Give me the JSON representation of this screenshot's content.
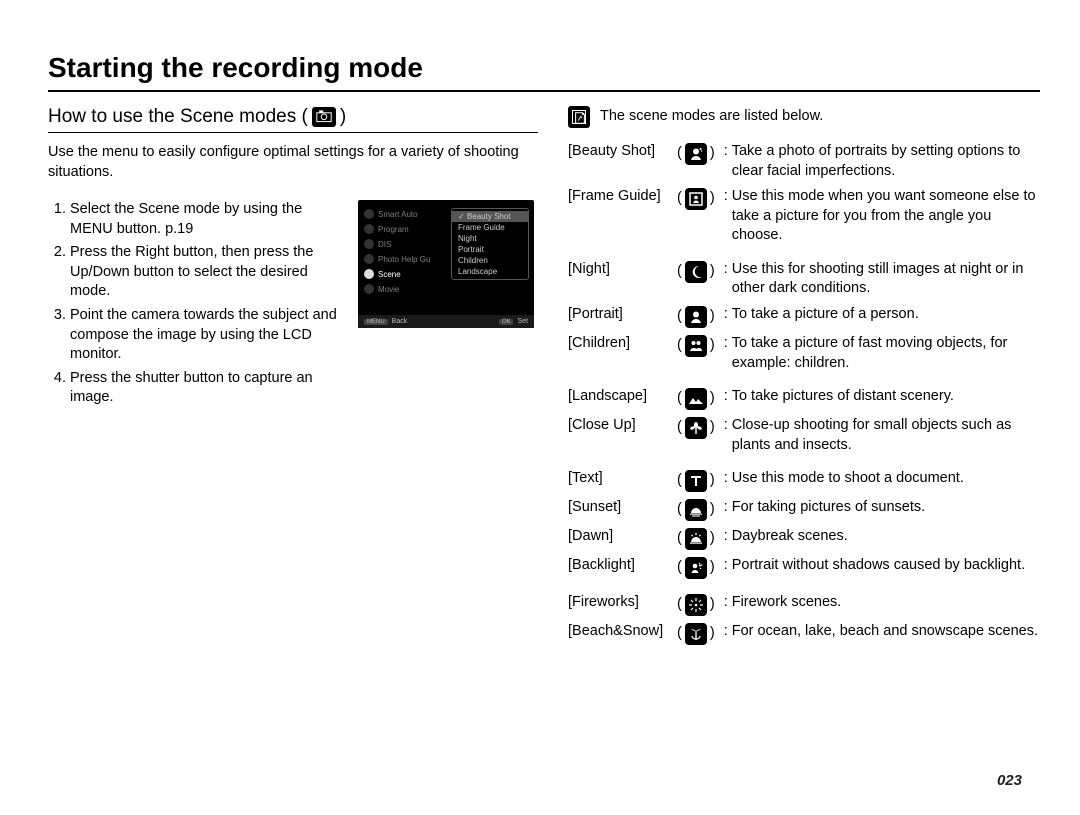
{
  "title": "Starting the recording mode",
  "subheading_prefix": "How to use the Scene modes (",
  "subheading_suffix": " )",
  "intro": "Use the menu to easily configure optimal settings for a variety of shooting situations.",
  "steps": [
    "Select the Scene mode by using the MENU button. p.19",
    "Press the Right button, then press the Up/Down button to select the desired mode.",
    "Point the camera towards the subject and compose the image by using the LCD monitor.",
    "Press the shutter button to capture an image."
  ],
  "lcd": {
    "left": [
      "Smart Auto",
      "Program",
      "DIS",
      "Photo Help Gu",
      "Scene",
      "Movie"
    ],
    "highlight_index": 4,
    "right": [
      "Beauty Shot",
      "Frame Guide",
      "Night",
      "Portrait",
      "Children",
      "Landscape"
    ],
    "selected_index": 0,
    "back": "Back",
    "set": "Set",
    "menu_key": "MENU",
    "ok_key": "OK"
  },
  "note_text": "The scene modes are listed below.",
  "modes": [
    {
      "label": "[Beauty Shot]",
      "icon": "beauty",
      "desc": "Take a photo of portraits by setting options to clear facial imperfections."
    },
    {
      "label": "[Frame Guide]",
      "icon": "frame",
      "desc": "Use this mode when you want someone else to take a picture for you from the angle you choose."
    },
    {
      "label": "[Night]",
      "icon": "night",
      "desc": "Use this for shooting still images at night or in other dark conditions."
    },
    {
      "label": "[Portrait]",
      "icon": "portrait",
      "desc": "To take a picture of a person."
    },
    {
      "label": "[Children]",
      "icon": "children",
      "desc": "To take a picture of fast moving objects, for example: children."
    },
    {
      "label": "[Landscape]",
      "icon": "landscape",
      "desc": "To take pictures of distant scenery."
    },
    {
      "label": "[Close Up]",
      "icon": "closeup",
      "desc": "Close-up shooting for small objects such as plants and insects."
    },
    {
      "label": "[Text]",
      "icon": "text",
      "desc": "Use this mode to shoot a document."
    },
    {
      "label": "[Sunset]",
      "icon": "sunset",
      "desc": "For taking pictures of sunsets."
    },
    {
      "label": "[Dawn]",
      "icon": "dawn",
      "desc": "Daybreak scenes."
    },
    {
      "label": "[Backlight]",
      "icon": "backlight",
      "desc": "Portrait without shadows caused by backlight."
    },
    {
      "label": "[Fireworks]",
      "icon": "fireworks",
      "desc": "Firework scenes."
    },
    {
      "label": "[Beach&Snow]",
      "icon": "beachsnow",
      "desc": "For ocean, lake, beach and snowscape scenes."
    }
  ],
  "page_number": "023"
}
